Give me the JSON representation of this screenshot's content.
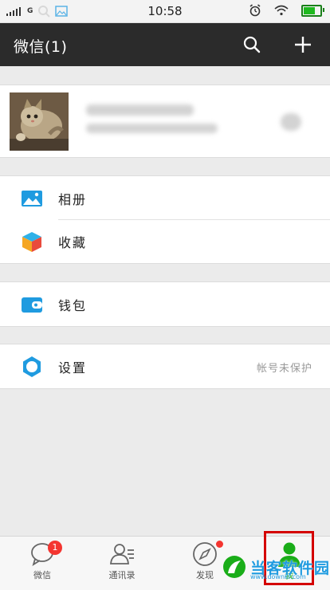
{
  "status_bar": {
    "network": "G",
    "time": "10:58",
    "battery_level": 0.8
  },
  "header": {
    "title": "微信(1)"
  },
  "menu": {
    "album": "相册",
    "favorites": "收藏",
    "wallet": "钱包",
    "settings": "设置",
    "settings_note": "帐号未保护"
  },
  "tabs": [
    {
      "label": "微信",
      "badge": "1"
    },
    {
      "label": "通讯录"
    },
    {
      "label": "发现"
    },
    {
      "label": "我"
    }
  ],
  "watermark": {
    "text": "当客软件园",
    "url": "www.downkr.com"
  },
  "colors": {
    "header_bg": "#2b2b2b",
    "accent_blue": "#1f9be0",
    "active_green": "#1aad19",
    "badge_red": "#f43530",
    "highlight_box": "#d40000"
  }
}
